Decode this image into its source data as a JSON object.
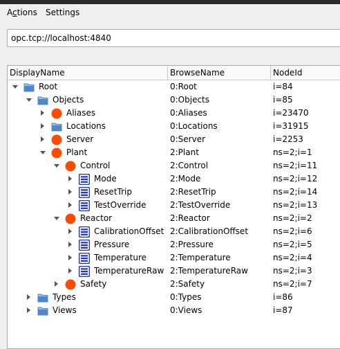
{
  "menubar": {
    "actions_prefix": "A",
    "actions_underlined": "c",
    "actions_rest": "tions",
    "settings": "Settings"
  },
  "address": {
    "value": "opc.tcp://localhost:4840"
  },
  "columns": {
    "display_name": "DisplayName",
    "browse_name": "BrowseName",
    "node_id": "NodeId"
  },
  "nodes": [
    {
      "display": "Root",
      "browse": "0:Root",
      "nodeid": "i=84",
      "level": 0,
      "icon": "folder",
      "expanded": true
    },
    {
      "display": "Objects",
      "browse": "0:Objects",
      "nodeid": "i=85",
      "level": 1,
      "icon": "folder",
      "expanded": true
    },
    {
      "display": "Aliases",
      "browse": "0:Aliases",
      "nodeid": "i=23470",
      "level": 2,
      "icon": "object",
      "expanded": false
    },
    {
      "display": "Locations",
      "browse": "0:Locations",
      "nodeid": "i=31915",
      "level": 2,
      "icon": "folder",
      "expanded": false
    },
    {
      "display": "Server",
      "browse": "0:Server",
      "nodeid": "i=2253",
      "level": 2,
      "icon": "object",
      "expanded": false
    },
    {
      "display": "Plant",
      "browse": "2:Plant",
      "nodeid": "ns=2;i=1",
      "level": 2,
      "icon": "object",
      "expanded": true
    },
    {
      "display": "Control",
      "browse": "2:Control",
      "nodeid": "ns=2;i=11",
      "level": 3,
      "icon": "object",
      "expanded": true
    },
    {
      "display": "Mode",
      "browse": "2:Mode",
      "nodeid": "ns=2;i=12",
      "level": 4,
      "icon": "variable",
      "expanded": false
    },
    {
      "display": "ResetTrip",
      "browse": "2:ResetTrip",
      "nodeid": "ns=2;i=14",
      "level": 4,
      "icon": "variable",
      "expanded": false
    },
    {
      "display": "TestOverride",
      "browse": "2:TestOverride",
      "nodeid": "ns=2;i=13",
      "level": 4,
      "icon": "variable",
      "expanded": false
    },
    {
      "display": "Reactor",
      "browse": "2:Reactor",
      "nodeid": "ns=2;i=2",
      "level": 3,
      "icon": "object",
      "expanded": true
    },
    {
      "display": "CalibrationOffset",
      "browse": "2:CalibrationOffset",
      "nodeid": "ns=2;i=6",
      "level": 4,
      "icon": "variable",
      "expanded": false
    },
    {
      "display": "Pressure",
      "browse": "2:Pressure",
      "nodeid": "ns=2;i=5",
      "level": 4,
      "icon": "variable",
      "expanded": false
    },
    {
      "display": "Temperature",
      "browse": "2:Temperature",
      "nodeid": "ns=2;i=4",
      "level": 4,
      "icon": "variable",
      "expanded": false
    },
    {
      "display": "TemperatureRaw",
      "browse": "2:TemperatureRaw",
      "nodeid": "ns=2;i=3",
      "level": 4,
      "icon": "variable",
      "expanded": false
    },
    {
      "display": "Safety",
      "browse": "2:Safety",
      "nodeid": "ns=2;i=7",
      "level": 3,
      "icon": "object",
      "expanded": false
    },
    {
      "display": "Types",
      "browse": "0:Types",
      "nodeid": "i=86",
      "level": 1,
      "icon": "folder",
      "expanded": false
    },
    {
      "display": "Views",
      "browse": "0:Views",
      "nodeid": "i=87",
      "level": 1,
      "icon": "folder",
      "expanded": false
    }
  ],
  "colors": {
    "object": "#ff4a00",
    "variable": "#1a2fd6",
    "folder": "#4f86c6",
    "folder_light": "#9cc3ea"
  }
}
